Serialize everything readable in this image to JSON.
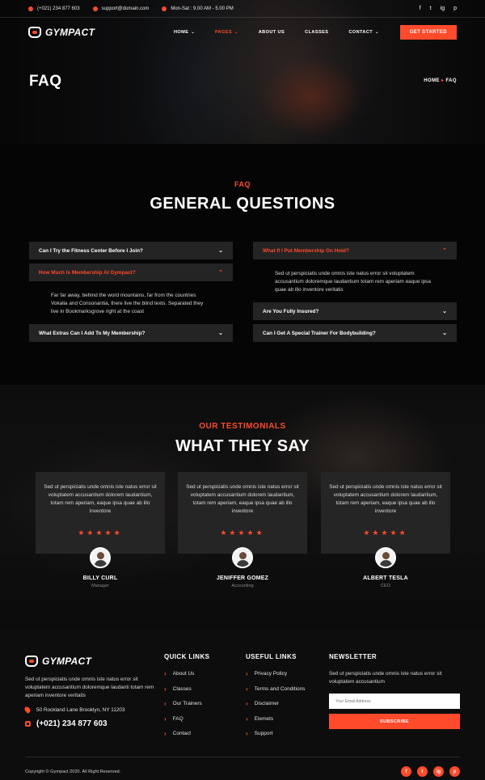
{
  "topbar": {
    "phone": "(+021) 234 877 603",
    "email": "support@domain.com",
    "hours": "Mon-Sat : 9.00 AM - 5.00 PM",
    "social": [
      "f",
      "t",
      "ig",
      "p"
    ]
  },
  "brand": {
    "name": "GYMPACT"
  },
  "nav": {
    "items": [
      "HOME",
      "PAGES",
      "ABOUT US",
      "CLASSES",
      "CONTACT"
    ],
    "cta": "GET STARTED"
  },
  "hero": {
    "title": "FAQ",
    "breadcrumb_home": "HOME",
    "breadcrumb_sep": "▸",
    "breadcrumb_current": "FAQ"
  },
  "faq": {
    "kicker": "FAQ",
    "heading": "GENERAL QUESTIONS",
    "left": [
      {
        "q": "Can I Try the Fitness Center Before I Join?"
      },
      {
        "q": "How Much Is Membership At Gympact?",
        "a": "Far far away, behind the word mountains, far from the countries Vokalia and Consonantia, there live the blind texts. Separated they live in Bookmarksgrove right at the coast"
      },
      {
        "q": "What Extras Can I Add To My Membership?"
      }
    ],
    "right": [
      {
        "q": "What If I Put Membership On Hold?",
        "a": "Sed ut perspiciatis unde omnis iste natus error sit voluptatem accusantium doloremque laudantium totam rem aperiam eaque ipsa quae ab illo inventore veritatis"
      },
      {
        "q": "Are You Fully Insured?"
      },
      {
        "q": "Can I Get A Special Trainer For Bodybuilding?"
      }
    ]
  },
  "testimonials": {
    "kicker": "OUR TESTIMONIALS",
    "heading": "WHAT THEY SAY",
    "items": [
      {
        "text": "Sed ut perspiciatis unde omnis iste natus error sit voluptatem accusantium dolorem laudantium, totam rem aperiam, eaque ipsa quae ab illo inventore",
        "name": "BILLY CURL",
        "role": "Manager",
        "stars": "★★★★★"
      },
      {
        "text": "Sed ut perspiciatis unde omnis iste natus error sit voluptatem accusantium dolorem laudantium, totam rem aperiam, eaque ipsa quae ab illo inventore",
        "name": "JENIFFER GOMEZ",
        "role": "Accounting",
        "stars": "★★★★★"
      },
      {
        "text": "Sed ut perspiciatis unde omnis iste natus error sit voluptatem accusantium dolorem laudantium, totam rem aperiam, eaque ipsa quae ab illo inventore",
        "name": "ALBERT TESLA",
        "role": "CEO",
        "stars": "★★★★★"
      }
    ]
  },
  "footer": {
    "about": "Sed ut perspiciatis unde omnis iste natus error sit voluptatem accusantium doloremque laudanti totam rem aperiam inventore veritatis",
    "address": "50 Rockland Lane Brooklyn, NY 11203",
    "phone": "(+021) 234 877 603",
    "quick_links_title": "QUICK LINKS",
    "quick_links": [
      "About Us",
      "Classes",
      "Our Trainers",
      "FAQ",
      "Contact"
    ],
    "useful_links_title": "USEFUL LINKS",
    "useful_links": [
      "Privacy Policy",
      "Terms and Conditions",
      "Disclaimer",
      "Elemets",
      "Support"
    ],
    "newsletter_title": "NEWSLETTER",
    "newsletter_text": "Sed ut perspiciatis unde omnis iste natus error sit voluptatem accusantium",
    "email_placeholder": "Your Email Address",
    "subscribe": "SUBSCRIBE",
    "copyright": "Copyright © Gympact 2020. All Right Reserved.",
    "social": [
      "f",
      "t",
      "ig",
      "p"
    ]
  },
  "colors": {
    "accent": "#ff4a2b",
    "panel": "#242424",
    "background": "#050505"
  },
  "icons": [
    "phone-icon",
    "mail-icon",
    "clock-icon",
    "facebook-icon",
    "twitter-icon",
    "instagram-icon",
    "pinterest-icon",
    "chevron-down-icon",
    "chevron-up-icon",
    "star-icon",
    "location-icon"
  ]
}
